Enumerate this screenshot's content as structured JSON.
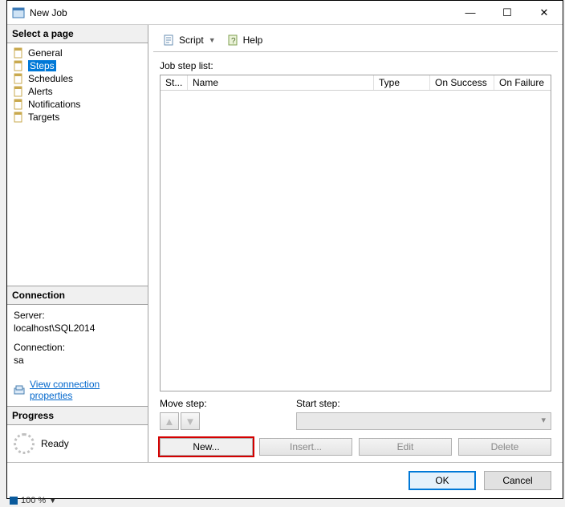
{
  "window": {
    "title": "New Job"
  },
  "sidebar": {
    "header": "Select a page",
    "items": [
      {
        "label": "General"
      },
      {
        "label": "Steps"
      },
      {
        "label": "Schedules"
      },
      {
        "label": "Alerts"
      },
      {
        "label": "Notifications"
      },
      {
        "label": "Targets"
      }
    ],
    "selected_index": 1
  },
  "connection": {
    "header": "Connection",
    "server_label": "Server:",
    "server_value": "localhost\\SQL2014",
    "conn_label": "Connection:",
    "conn_value": "sa",
    "view_props": "View connection properties"
  },
  "progress": {
    "header": "Progress",
    "status": "Ready"
  },
  "toolbar": {
    "script": "Script",
    "help": "Help"
  },
  "main": {
    "list_label": "Job step list:",
    "columns": {
      "st": "St...",
      "name": "Name",
      "type": "Type",
      "on_success": "On Success",
      "on_failure": "On Failure"
    },
    "move_label": "Move step:",
    "start_label": "Start step:",
    "start_value": "",
    "buttons": {
      "new": "New...",
      "insert": "Insert...",
      "edit": "Edit",
      "delete": "Delete"
    }
  },
  "footer": {
    "ok": "OK",
    "cancel": "Cancel"
  },
  "bottom": {
    "zoom": "100 %"
  }
}
